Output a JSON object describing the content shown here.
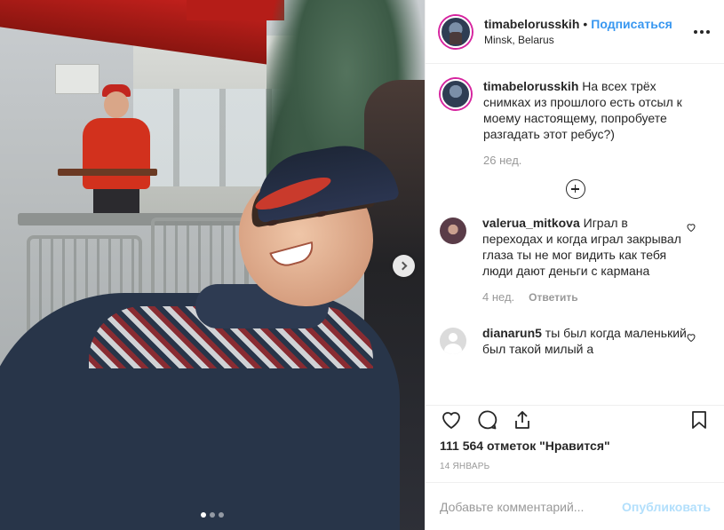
{
  "post": {
    "username": "timabelorusskih",
    "separator": "•",
    "follow_label": "Подписаться",
    "location": "Minsk, Belarus"
  },
  "caption": {
    "username": "timabelorusskih",
    "text": "На всех трёх снимках из прошлого есть отсыл к моему настоящему, попробуете разгадать этот ребус?)",
    "time": "26 нед."
  },
  "comments": [
    {
      "username": "valerua_mitkova",
      "text": "Играл в переходах и когда играл закрывал глаза ты не мог видить как тебя люди дают деньги с кармана",
      "time": "4 нед.",
      "reply_label": "Ответить"
    },
    {
      "username": "dianarun5",
      "text": "ты был когда маленький был такой милый а"
    }
  ],
  "likes": "111 564 отметок \"Нравится\"",
  "date": "14 ЯНВАРЬ",
  "add_comment": {
    "placeholder": "Добавьте комментарий...",
    "publish_label": "Опубликовать"
  },
  "carousel": {
    "total": 3,
    "active_index": 0
  },
  "icons": {
    "like": "heart-icon",
    "comment": "comment-icon",
    "share": "share-icon",
    "save": "bookmark-icon",
    "more": "more-icon"
  }
}
